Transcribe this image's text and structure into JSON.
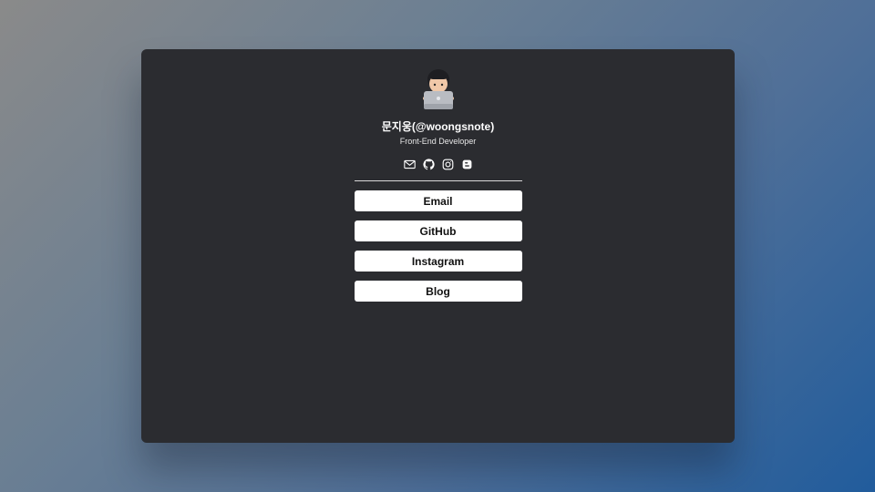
{
  "profile": {
    "name": "문지웅(@woongsnote)",
    "role": "Front-End Developer",
    "avatar_icon": "memoji-laptop-avatar"
  },
  "social_icons": [
    {
      "name": "mail-icon"
    },
    {
      "name": "github-icon"
    },
    {
      "name": "instagram-icon"
    },
    {
      "name": "blogger-icon"
    }
  ],
  "links": [
    {
      "label": "Email"
    },
    {
      "label": "GitHub"
    },
    {
      "label": "Instagram"
    },
    {
      "label": "Blog"
    }
  ],
  "colors": {
    "card_background": "#2b2c30",
    "button_background": "#ffffff",
    "text_primary": "#ffffff"
  }
}
